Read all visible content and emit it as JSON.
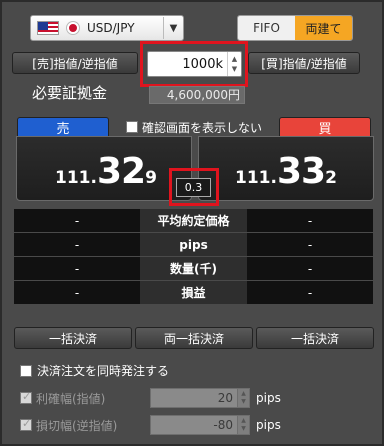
{
  "header": {
    "pair_label": "USD/JPY",
    "mode_fifo": "FIFO",
    "mode_ryodate": "両建て"
  },
  "order": {
    "sell_limit_stop_label": "[売]指値/逆指値",
    "buy_limit_stop_label": "[買]指値/逆指値",
    "quantity_value": "1000k",
    "margin_label": "必要証拠金",
    "margin_value": "4,600,000円"
  },
  "trade": {
    "sell_label": "売",
    "buy_label": "買",
    "confirm_label": "確認画面を表示しない",
    "sell_price": {
      "small": "111.",
      "big": "32",
      "pip": "9"
    },
    "buy_price": {
      "small": "111.",
      "big": "33",
      "pip": "2"
    },
    "spread": "0.3"
  },
  "positions": {
    "rows": [
      {
        "sell": "-",
        "label": "平均約定価格",
        "buy": "-"
      },
      {
        "sell": "-",
        "label": "pips",
        "buy": "-"
      },
      {
        "sell": "-",
        "label": "数量(千)",
        "buy": "-"
      },
      {
        "sell": "-",
        "label": "損益",
        "buy": "-"
      }
    ]
  },
  "settle": {
    "bulk_sell": "一括決済",
    "bulk_both": "両一括決済",
    "bulk_buy": "一括決済"
  },
  "oco": {
    "simultaneous_label": "決済注文を同時発注する",
    "take_profit_label": "利確幅(指値)",
    "take_profit_value": "20",
    "take_profit_unit": "pips",
    "stop_loss_label": "損切幅(逆指値)",
    "stop_loss_value": "-80",
    "stop_loss_unit": "pips"
  },
  "colors": {
    "sell_tab": "#1f5fd0",
    "buy_tab": "#e8443a",
    "mode_active": "#f5a623",
    "highlight": "#e0141e"
  }
}
